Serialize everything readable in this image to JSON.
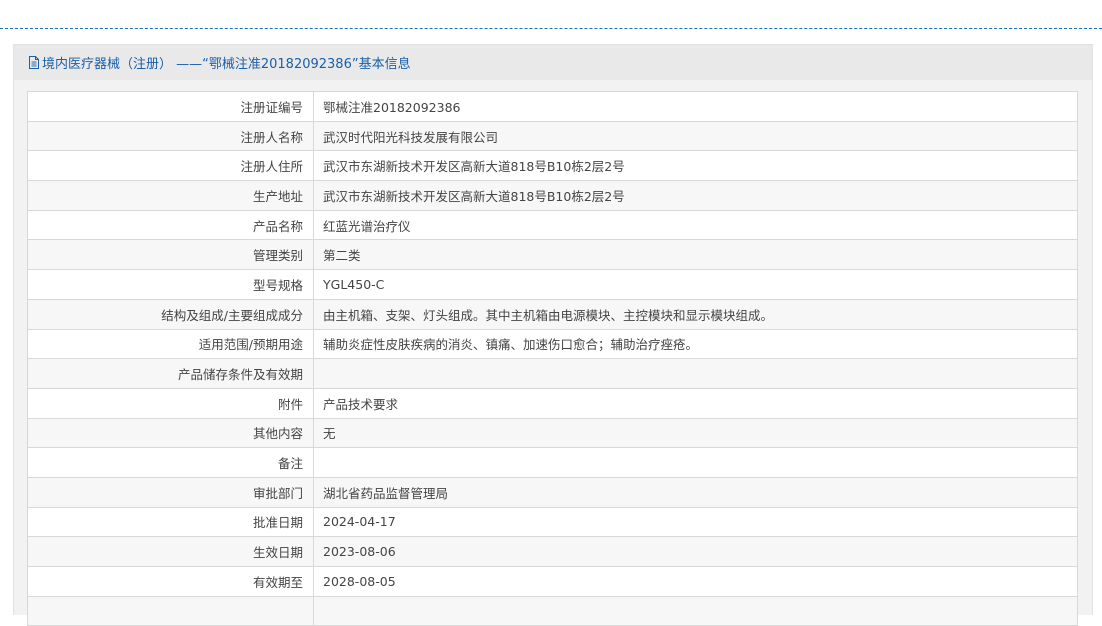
{
  "panel": {
    "title": "境内医疗器械（注册） ——“鄂械注准20182092386”基本信息",
    "icon": "document-icon"
  },
  "rows": [
    {
      "label": "注册证编号",
      "value": "鄂械注准20182092386"
    },
    {
      "label": "注册人名称",
      "value": "武汉时代阳光科技发展有限公司"
    },
    {
      "label": "注册人住所",
      "value": "武汉市东湖新技术开发区高新大道818号B10栋2层2号"
    },
    {
      "label": "生产地址",
      "value": "武汉市东湖新技术开发区高新大道818号B10栋2层2号"
    },
    {
      "label": "产品名称",
      "value": "红蓝光谱治疗仪"
    },
    {
      "label": "管理类别",
      "value": "第二类"
    },
    {
      "label": "型号规格",
      "value": "YGL450-C"
    },
    {
      "label": "结构及组成/主要组成成分",
      "value": "由主机箱、支架、灯头组成。其中主机箱由电源模块、主控模块和显示模块组成。"
    },
    {
      "label": "适用范围/预期用途",
      "value": "辅助炎症性皮肤疾病的消炎、镇痛、加速伤口愈合；辅助治疗痤疮。"
    },
    {
      "label": "产品储存条件及有效期",
      "value": ""
    },
    {
      "label": "附件",
      "value": "产品技术要求"
    },
    {
      "label": "其他内容",
      "value": "无"
    },
    {
      "label": "备注",
      "value": ""
    },
    {
      "label": "审批部门",
      "value": "湖北省药品监督管理局"
    },
    {
      "label": "批准日期",
      "value": "2024-04-17"
    },
    {
      "label": "生效日期",
      "value": "2023-08-06"
    },
    {
      "label": "有效期至",
      "value": "2028-08-05"
    },
    {
      "label": "",
      "value": ""
    }
  ],
  "colors": {
    "accent": "#1a5fa8",
    "row_alt": "#f7f7f7",
    "border": "#d8d8d8"
  }
}
